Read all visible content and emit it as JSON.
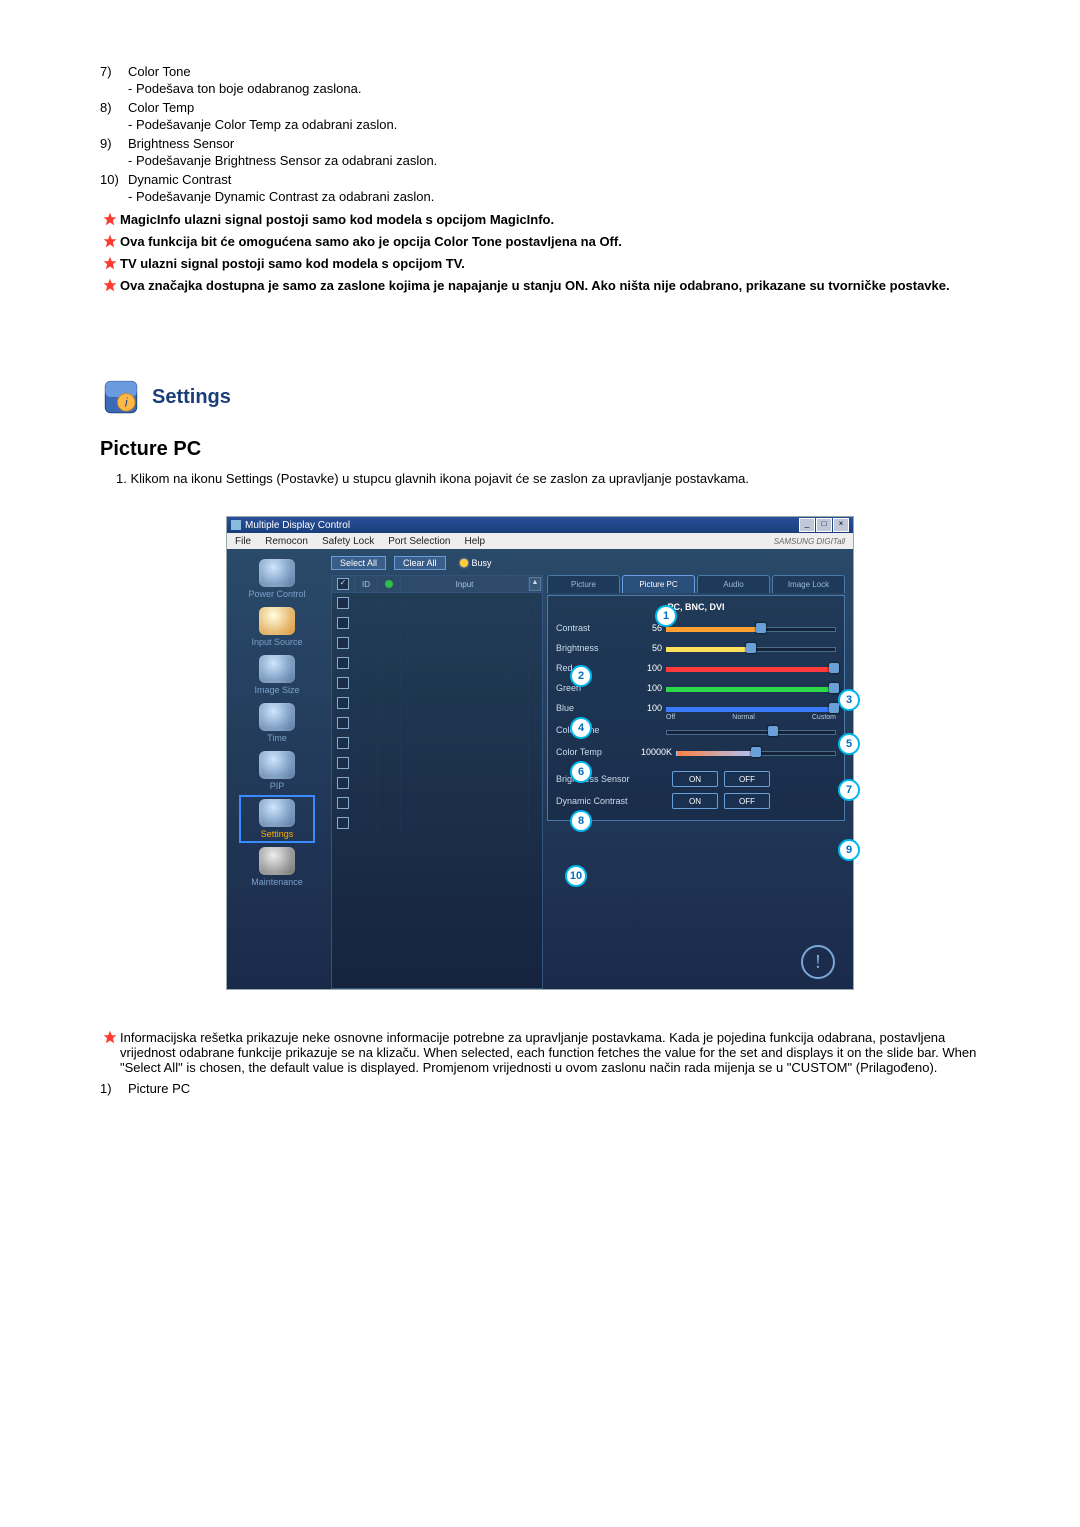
{
  "list": [
    {
      "n": "7)",
      "title": "Color Tone",
      "desc": "- Podešava ton boje odabranog zaslona."
    },
    {
      "n": "8)",
      "title": "Color Temp",
      "desc": "- Podešavanje Color Temp za odabrani zaslon."
    },
    {
      "n": "9)",
      "title": "Brightness Sensor",
      "desc": "- Podešavanje Brightness Sensor za odabrani zaslon."
    },
    {
      "n": "10)",
      "title": "Dynamic Contrast",
      "desc": "- Podešavanje Dynamic Contrast za odabrani zaslon."
    }
  ],
  "stars": [
    "MagicInfo ulazni signal postoji samo kod modela s opcijom MagicInfo.",
    "Ova funkcija bit će omogućena samo ako je opcija Color Tone postavljena na Off.",
    "TV ulazni signal postoji samo kod modela s opcijom TV.",
    "Ova značajka dostupna je samo za zaslone kojima je napajanje u stanju ON. Ako ništa nije odabrano, prikazane su tvorničke postavke."
  ],
  "settings_heading": "Settings",
  "picpc_heading": "Picture PC",
  "intro": "1. Klikom na ikonu Settings (Postavke) u stupcu glavnih ikona pojavit će se zaslon za upravljanje postavkama.",
  "mdc": {
    "title": "Multiple Display Control",
    "menu": [
      "File",
      "Remocon",
      "Safety Lock",
      "Port Selection",
      "Help"
    ],
    "brand": "SAMSUNG DIGITall",
    "toolbar": {
      "selectall": "Select All",
      "clearall": "Clear All",
      "busy": "Busy"
    },
    "sidebar": [
      {
        "label": "Power Control"
      },
      {
        "label": "Input Source"
      },
      {
        "label": "Image Size"
      },
      {
        "label": "Time"
      },
      {
        "label": "PIP"
      },
      {
        "label": "Settings"
      },
      {
        "label": "Maintenance"
      }
    ],
    "grid": {
      "h_id": "ID",
      "h_input": "Input"
    },
    "tabs": [
      "Picture",
      "Picture PC",
      "Audio",
      "Image Lock"
    ],
    "panel_title": "PC, BNC, DVI",
    "rows": {
      "contrast": {
        "label": "Contrast",
        "val": "56"
      },
      "brightness": {
        "label": "Brightness",
        "val": "50"
      },
      "red": {
        "label": "Red",
        "val": "100"
      },
      "green": {
        "label": "Green",
        "val": "100"
      },
      "blue": {
        "label": "Blue",
        "val": "100"
      },
      "colortone": {
        "label": "Color Tone",
        "off": "Off",
        "normal": "Normal",
        "custom": "Custom"
      },
      "colortemp": {
        "label": "Color Temp",
        "val": "10000K"
      },
      "bsensor": {
        "label": "Brightness Sensor",
        "on": "ON",
        "off": "OFF"
      },
      "dcontrast": {
        "label": "Dynamic Contrast",
        "on": "ON",
        "off": "OFF"
      }
    }
  },
  "callouts": [
    "1",
    "2",
    "3",
    "4",
    "5",
    "6",
    "7",
    "8",
    "9",
    "10"
  ],
  "footnote_star": "Informacijska rešetka prikazuje neke osnovne informacije potrebne za upravljanje postavkama. Kada je pojedina funkcija odabrana, postavljena vrijednost odabrane funkcije prikazuje se na klizaču. When selected, each function fetches the value for the set and displays it on the slide bar. When \"Select All\" is chosen, the default value is displayed. Promjenom vrijednosti u ovom zaslonu način rada mijenja se u \"CUSTOM\" (Prilagođeno).",
  "footnote_items": [
    {
      "n": "1)",
      "title": "Picture PC"
    }
  ]
}
